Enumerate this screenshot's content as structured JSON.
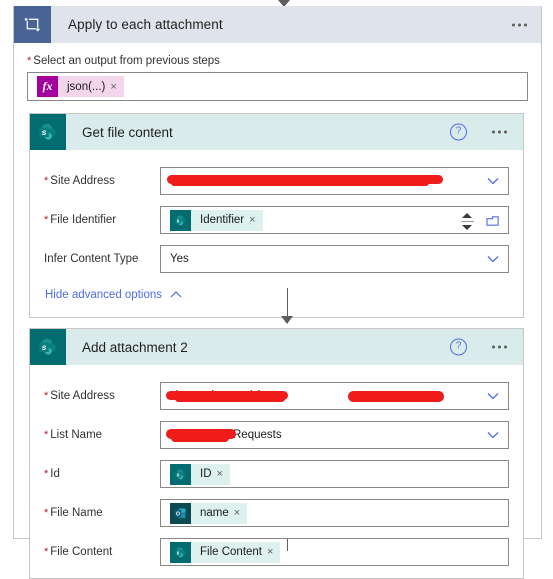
{
  "scope": {
    "icon": "loop-icon",
    "title": "Apply to each attachment",
    "ellipsis": "more-commands",
    "output_field": {
      "label": "Select an output from previous steps",
      "required_marker": "*",
      "token": {
        "icon": "fx-icon",
        "icon_glyph": "fx",
        "label": "json(...)",
        "remove": "×"
      }
    }
  },
  "actions": [
    {
      "name": "get-file-content",
      "icon": "sharepoint-icon",
      "title": "Get file content",
      "help": "?",
      "fields": [
        {
          "name": "site-address",
          "label": "Site Address",
          "required": true,
          "type": "combo",
          "value": "",
          "redacted": true,
          "chevron": "chevron-down-icon"
        },
        {
          "name": "file-identifier",
          "label": "File Identifier",
          "required": true,
          "type": "token",
          "token": {
            "icon": "sharepoint-icon",
            "label": "Identifier",
            "remove": "×"
          },
          "spinner": "spinner-control",
          "picker": "folder-picker-icon"
        },
        {
          "name": "infer-content-type",
          "label": "Infer Content Type",
          "required": false,
          "type": "combo",
          "value": "Yes",
          "redacted": false,
          "chevron": "chevron-down-icon"
        }
      ],
      "advanced_link": {
        "label": "Hide advanced options",
        "icon": "chevron-up-icon"
      }
    },
    {
      "name": "add-attachment-2",
      "icon": "sharepoint-icon",
      "title": "Add attachment 2",
      "help": "?",
      "fields": [
        {
          "name": "site-address",
          "label": "Site Address",
          "required": true,
          "type": "combo",
          "value": "sharepoint.com/si",
          "redacted": true,
          "chevron": "chevron-down-icon"
        },
        {
          "name": "list-name",
          "label": "List Name",
          "required": true,
          "type": "combo",
          "value": "Requests",
          "redacted": true,
          "chevron": "chevron-down-icon"
        },
        {
          "name": "id",
          "label": "Id",
          "required": true,
          "type": "token",
          "token": {
            "icon": "sharepoint-icon",
            "label": "ID",
            "remove": "×"
          }
        },
        {
          "name": "file-name",
          "label": "File Name",
          "required": true,
          "type": "token",
          "token": {
            "icon": "outlook-icon",
            "label": "name",
            "remove": "×"
          }
        },
        {
          "name": "file-content",
          "label": "File Content",
          "required": true,
          "type": "token",
          "token": {
            "icon": "sharepoint-icon",
            "label": "File Content",
            "remove": "×"
          }
        }
      ]
    }
  ],
  "colors": {
    "scope_header_bg": "#dfe3eb",
    "scope_icon_bg": "#486494",
    "action_header_bg": "#d9eceb",
    "sharepoint_teal": "#036c70",
    "accent_link": "#4f6bed",
    "required_red": "#a4262c",
    "redaction_red": "#f01c1c",
    "fx_magenta": "#a4009e"
  }
}
